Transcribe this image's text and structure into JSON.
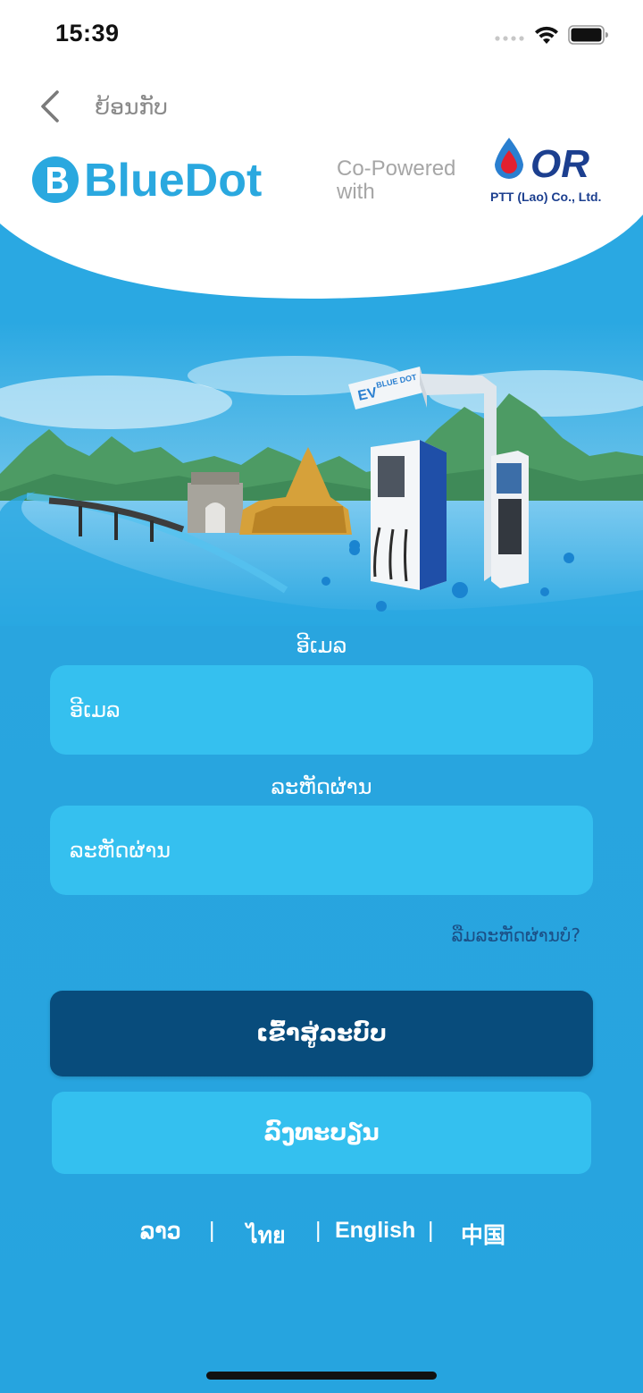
{
  "status_bar": {
    "time": "15:39"
  },
  "header": {
    "back_label": "ຍ້ອນກັບ",
    "brand_name": "BlueDot",
    "cobrand_line1": "Co-Powered",
    "cobrand_line2": "with",
    "partner_mark": "OR",
    "partner_caption": "PTT (Lao) Co., Ltd."
  },
  "hero": {
    "charger_brand_top": "EV",
    "charger_brand_sign": "BLUE DOT"
  },
  "form": {
    "email_label": "ອີເມລ",
    "email_placeholder": "ອີເມລ",
    "password_label": "ລະຫັດຜ່ານ",
    "password_placeholder": "ລະຫັດຜ່ານ",
    "forgot_password": "ລືມລະຫັດຜ່ານບໍ?",
    "login_button": "ເຂົ້າສູ່ລະບົບ",
    "register_button": "ລົງທະບຽນ"
  },
  "languages": {
    "lao": "ລາວ",
    "thai": "ไทย",
    "english": "English",
    "chinese": "中国",
    "separator": "|"
  },
  "colors": {
    "background": "#29a7e1",
    "input_bg": "#35c0ef",
    "login_bg": "#084c7c",
    "register_bg": "#34c0ef",
    "brand_blue": "#2aa8df",
    "partner_blue": "#1c3f8f",
    "partner_red": "#e3202f"
  }
}
